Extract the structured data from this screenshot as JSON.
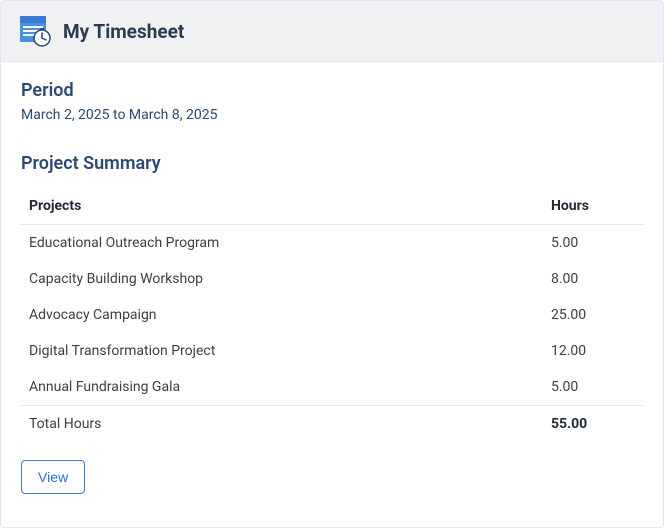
{
  "header": {
    "title": "My Timesheet"
  },
  "period": {
    "label": "Period",
    "range": "March 2, 2025 to March 8, 2025"
  },
  "summary": {
    "heading": "Project Summary",
    "columns": {
      "projects": "Projects",
      "hours": "Hours"
    },
    "rows": [
      {
        "project": "Educational Outreach Program",
        "hours": "5.00"
      },
      {
        "project": "Capacity Building Workshop",
        "hours": "8.00"
      },
      {
        "project": "Advocacy Campaign",
        "hours": "25.00"
      },
      {
        "project": "Digital Transformation Project",
        "hours": "12.00"
      },
      {
        "project": "Annual Fundraising Gala",
        "hours": "5.00"
      }
    ],
    "total": {
      "label": "Total Hours",
      "hours": "55.00"
    }
  },
  "actions": {
    "view": "View"
  }
}
